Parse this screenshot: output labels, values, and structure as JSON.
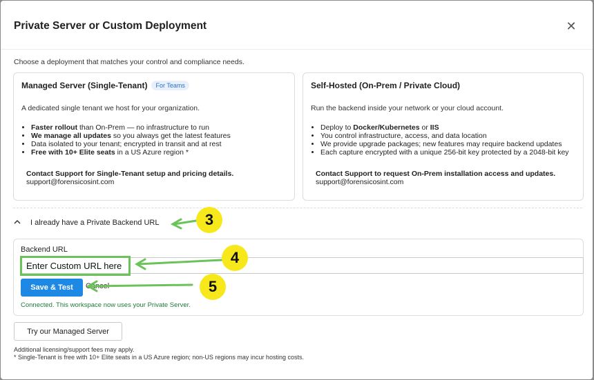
{
  "modal": {
    "title": "Private Server or Custom Deployment",
    "close_label": "✕",
    "intro": "Choose a deployment that matches your control and compliance needs."
  },
  "managed": {
    "title": "Managed Server (Single-Tenant)",
    "badge": "For Teams",
    "description": "A dedicated single tenant we host for your organization.",
    "bullets": [
      {
        "bold": "Faster rollout",
        "text": " than On-Prem — no infrastructure to run"
      },
      {
        "bold": "We manage all updates",
        "text": " so you always get the latest features"
      },
      {
        "bold": "",
        "text": "Data isolated to your tenant; encrypted in transit and at rest"
      },
      {
        "bold": "Free with 10+ Elite seats",
        "text": " in a US Azure region *"
      }
    ],
    "contact_title": "Contact Support for Single-Tenant setup and pricing details.",
    "contact_email": "support@forensicosint.com"
  },
  "selfhosted": {
    "title": "Self-Hosted (On-Prem / Private Cloud)",
    "description": "Run the backend inside your network or your cloud account.",
    "bullets": [
      {
        "pre": "Deploy to ",
        "bold": "Docker/Kubernetes",
        "mid": " or ",
        "bold2": "IIS"
      },
      {
        "pre": "You control infrastructure, access, and data location"
      },
      {
        "pre": "We provide upgrade packages; new features may require backend updates"
      },
      {
        "pre": "Each capture encrypted with a unique 256-bit key protected by a 2048-bit key"
      }
    ],
    "contact_title": "Contact Support to request On-Prem installation access and updates.",
    "contact_email": "support@forensicosint.com"
  },
  "backend": {
    "toggle_label": "I already have a Private Backend URL",
    "url_label": "Backend URL",
    "url_placeholder": "Enter Custom URL here",
    "url_value": "",
    "save_label": "Save & Test",
    "cancel_label": "Cancel",
    "status": "Connected. This workspace now uses your Private Server."
  },
  "footer": {
    "managed_button": "Try our Managed Server",
    "note1": "Additional licensing/support fees may apply.",
    "note2": "* Single-Tenant is free with 10+ Elite seats in a US Azure region; non-US regions may incur hosting costs."
  },
  "callouts": [
    "3",
    "4",
    "5"
  ],
  "colors": {
    "accent": "#1e88e5",
    "callout": "#f7e81c",
    "arrow": "#6ac259",
    "status": "#1f7a3a"
  }
}
